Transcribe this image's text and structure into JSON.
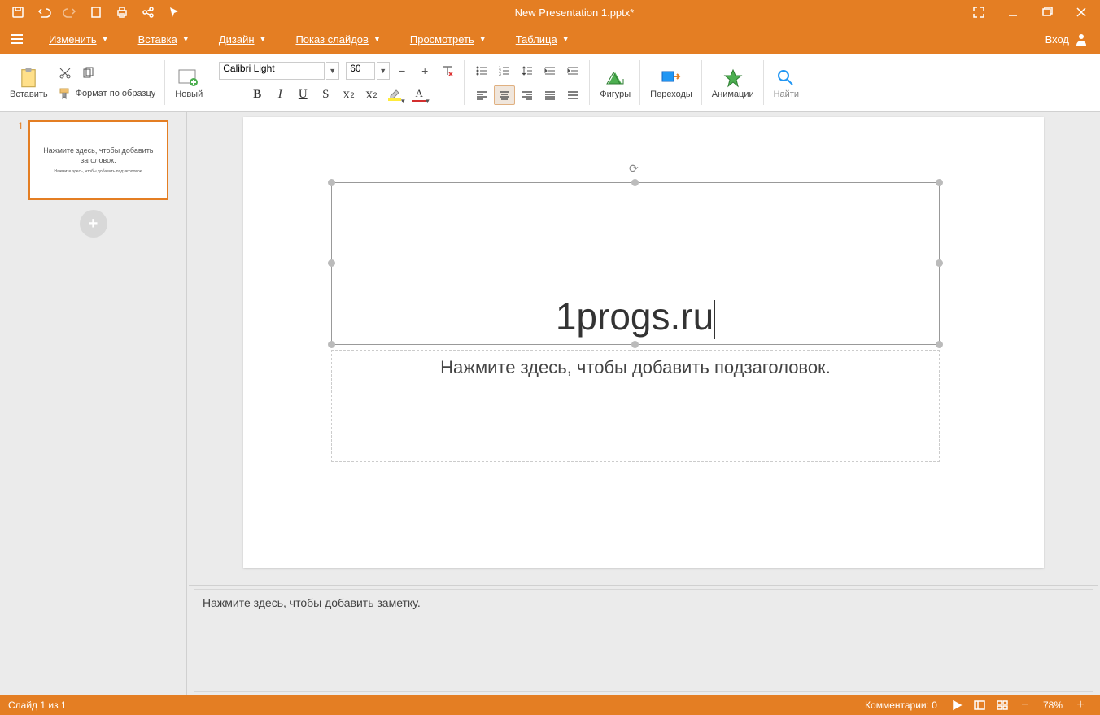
{
  "title": "New Presentation 1.pptx*",
  "menu": {
    "edit": "Изменить",
    "insert": "Вставка",
    "design": "Дизайн",
    "slideshow": "Показ слайдов",
    "view": "Просмотреть",
    "table": "Таблица",
    "login": "Вход"
  },
  "toolbar": {
    "paste": "Вставить",
    "format_painter": "Формат по образцу",
    "new": "Новый",
    "font_name": "Calibri Light",
    "font_size": "60",
    "shapes": "Фигуры",
    "transitions": "Переходы",
    "animations": "Анимации",
    "find": "Найти"
  },
  "slide": {
    "number": "1",
    "title_text": "1progs.ru",
    "subtitle_placeholder": "Нажмите здесь, чтобы добавить подзаголовок.",
    "thumb_title": "Нажмите здесь, чтобы добавить заголовок.",
    "thumb_sub": "Нажмите здесь, чтобы добавить подзаголовок."
  },
  "notes": {
    "placeholder": "Нажмите здесь, чтобы добавить заметку."
  },
  "status": {
    "slide_info": "Слайд 1 из 1",
    "comments": "Комментарии: 0",
    "zoom": "78%"
  },
  "colors": {
    "accent": "#e47e23",
    "highlight": "#ffeb3b",
    "fontcolor": "#d32f2f"
  }
}
